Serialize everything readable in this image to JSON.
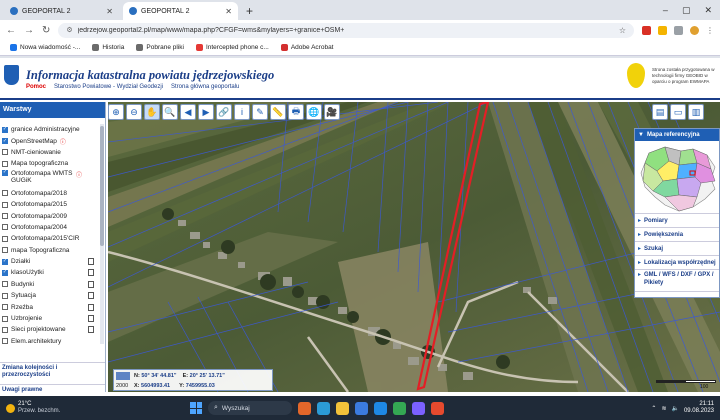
{
  "browser": {
    "tabs": [
      {
        "label": "GEOPORTAL 2",
        "active": false
      },
      {
        "label": "GEOPORTAL 2",
        "active": true
      }
    ],
    "new_tab": "+",
    "controls": {
      "minimize": "–",
      "restore": "▢",
      "close": "✕"
    },
    "url": "jedrzejow.geoportal2.pl/map/www/mapa.php?CFGF=wms&mylayers=+granice+OSM+",
    "bookmarks": [
      {
        "label": "Nowa wiadomość -...",
        "color": "#1a73e8"
      },
      {
        "label": "Historia",
        "color": "#6b6b6b"
      },
      {
        "label": "Pobrane pliki",
        "color": "#6b6b6b"
      },
      {
        "label": "Intercepted phone c...",
        "color": "#e53935"
      },
      {
        "label": "Adobe Acrobat",
        "color": "#d32f2f"
      }
    ]
  },
  "header": {
    "title": "Informacja katastralna powiatu jędrzejowskiego",
    "home": "Pomoc",
    "links": [
      "Starostwo Powiatowe - Wydział Geodezji",
      "Strona główna geoportalu"
    ],
    "badge_text": "GEOBID",
    "note": "Strona została przygotowana w technologii firmy GEOBID w oparciu o program EWMAPA"
  },
  "sidebar": {
    "title": "Warstwy",
    "layers": [
      {
        "label": "granice Administracyjne",
        "checked": true,
        "info": false,
        "legend": false
      },
      {
        "label": "OpenStreetMap",
        "checked": true,
        "info": true,
        "legend": false
      },
      {
        "label": "NMT-cieniowanie",
        "checked": false,
        "info": false,
        "legend": false
      },
      {
        "label": "Mapa topograficzna",
        "checked": false,
        "info": false,
        "legend": false
      },
      {
        "label": "Ortofotomapa WMTS GUGiK",
        "checked": true,
        "info": true,
        "legend": false,
        "tall": true
      },
      {
        "label": "Ortofotomapa/2018",
        "checked": false,
        "info": false,
        "legend": false
      },
      {
        "label": "Ortofotomapa/2015",
        "checked": false,
        "info": false,
        "legend": false
      },
      {
        "label": "Ortofotomapa/2009",
        "checked": false,
        "info": false,
        "legend": false
      },
      {
        "label": "Ortofotomapa/2004",
        "checked": false,
        "info": false,
        "legend": false
      },
      {
        "label": "Ortofotomapa/2015'CIR",
        "checked": false,
        "info": false,
        "legend": false
      },
      {
        "label": "mapa Topograficzna",
        "checked": false,
        "info": false,
        "legend": false
      },
      {
        "label": "Działki",
        "checked": true,
        "info": false,
        "legend": true
      },
      {
        "label": "klasoUżytki",
        "checked": true,
        "info": false,
        "legend": true
      },
      {
        "label": "Budynki",
        "checked": false,
        "info": false,
        "legend": true
      },
      {
        "label": "Sytuacja",
        "checked": false,
        "info": false,
        "legend": true
      },
      {
        "label": "Rzeźba",
        "checked": false,
        "info": false,
        "legend": true
      },
      {
        "label": "Uzbrojenie",
        "checked": false,
        "info": false,
        "legend": true
      },
      {
        "label": "Sieci projektowane",
        "checked": false,
        "info": false,
        "legend": true
      },
      {
        "label": "Elem.architektury",
        "checked": false,
        "info": false,
        "legend": false
      }
    ],
    "footer_order": "Zmiana kolejności i przezroczystości",
    "footer_legal": "Uwagi prawne"
  },
  "toolbar": {
    "tools": [
      {
        "name": "zoom-in-icon",
        "glyph": "⊕"
      },
      {
        "name": "zoom-out-icon",
        "glyph": "⊖"
      },
      {
        "name": "pan-hand-icon",
        "glyph": "✋",
        "active": true
      },
      {
        "name": "zoom-window-icon",
        "glyph": "🔍"
      },
      {
        "name": "back-arrow-icon",
        "glyph": "◀"
      },
      {
        "name": "forward-arrow-icon",
        "glyph": "▶"
      },
      {
        "name": "link-icon",
        "glyph": "🔗"
      },
      {
        "name": "info-icon",
        "glyph": "i"
      },
      {
        "name": "measure-icon",
        "glyph": "✎"
      },
      {
        "name": "ruler-icon",
        "glyph": "📏"
      },
      {
        "name": "print-icon",
        "glyph": "🖶"
      },
      {
        "name": "globe-icon",
        "glyph": "🌐"
      },
      {
        "name": "video-icon",
        "glyph": "🎥"
      }
    ],
    "right_tools": [
      {
        "name": "layout-left-icon",
        "glyph": "▤"
      },
      {
        "name": "layout-full-icon",
        "glyph": "▭"
      },
      {
        "name": "layout-right-icon",
        "glyph": "▥"
      }
    ]
  },
  "right_panel": {
    "title": "Mapa referencyjna",
    "items": [
      "Pomiary",
      "Powiększenia",
      "Szukaj",
      "Lokalizacja współrzędnej",
      "GML / WFS / DXF / GPX / Pikiety"
    ]
  },
  "coords": {
    "epsg": "2000",
    "n_label": "N:",
    "n_val": "50° 34' 44.81\"",
    "e_label": "E:",
    "e_val": "20° 25' 13.71\"",
    "x_label": "X:",
    "x_val": "5604993.41",
    "y_label": "Y:",
    "y_val": "7459955.03"
  },
  "scale": {
    "label": "100"
  },
  "taskbar": {
    "temp": "21°C",
    "weather": "Przew. bezchm.",
    "search": "Wyszukaj",
    "apps": [
      "#e3672a",
      "#2b9bd6",
      "#f2c23a",
      "#3b7be0",
      "#1e88e5",
      "#34a853",
      "#7b61ff",
      "#e64a2e"
    ],
    "time": "21:11",
    "date": "09.08.2023"
  }
}
